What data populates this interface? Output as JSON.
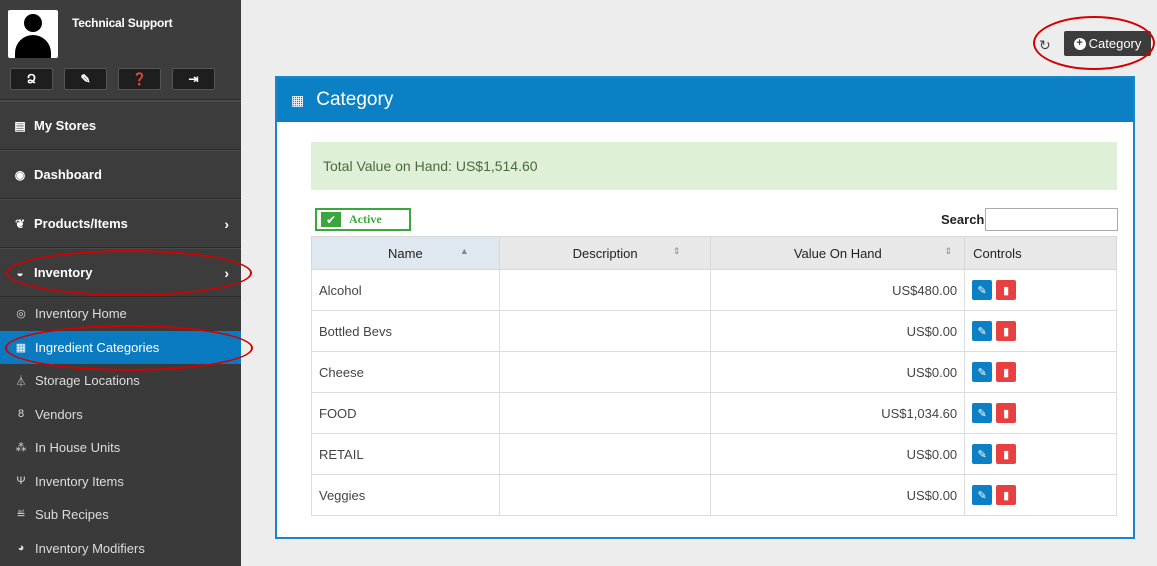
{
  "user": {
    "name": "Technical Support"
  },
  "profile_icons": [
    {
      "icon": "user-icon",
      "glyph": "Ձ"
    },
    {
      "icon": "brush-icon",
      "glyph": "✎"
    },
    {
      "icon": "help-icon",
      "glyph": "❓"
    },
    {
      "icon": "logout-icon",
      "glyph": "⇥"
    }
  ],
  "nav": {
    "my_stores": "My Stores",
    "dashboard": "Dashboard",
    "products": "Products/Items",
    "inventory": "Inventory"
  },
  "sub_nav": [
    {
      "name": "sub-item-inventory-home",
      "icon": "compass-icon",
      "glyph": "◎",
      "label": "Inventory Home",
      "active": false
    },
    {
      "name": "sub-item-ingredient-categories",
      "icon": "grid-icon",
      "glyph": "▦",
      "label": "Ingredient Categories",
      "active": true
    },
    {
      "name": "sub-item-storage-locations",
      "icon": "flask-icon",
      "glyph": "⏃",
      "label": "Storage Locations",
      "active": false
    },
    {
      "name": "sub-item-vendors",
      "icon": "vendor-icon",
      "glyph": "8",
      "label": "Vendors",
      "active": false
    },
    {
      "name": "sub-item-in-house-units",
      "icon": "cubes-icon",
      "glyph": "⁂",
      "label": "In House Units",
      "active": false
    },
    {
      "name": "sub-item-inventory-items",
      "icon": "utensils-icon",
      "glyph": "Ψ",
      "label": "Inventory Items",
      "active": false
    },
    {
      "name": "sub-item-sub-recipes",
      "icon": "recipe-icon",
      "glyph": "≝",
      "label": "Sub Recipes",
      "active": false
    },
    {
      "name": "sub-item-inventory-modifiers",
      "icon": "pie-icon",
      "glyph": "◕",
      "label": "Inventory Modifiers",
      "active": false
    }
  ],
  "toolbar": {
    "add_category_label": "Category"
  },
  "panel": {
    "title": "Category"
  },
  "summary": {
    "total_value": "Total Value on Hand: US$1,514.60"
  },
  "filter": {
    "active_label": "Active"
  },
  "search": {
    "label": "Search",
    "value": ""
  },
  "table": {
    "headers": {
      "name": "Name",
      "description": "Description",
      "value": "Value On Hand",
      "controls": "Controls"
    },
    "rows": [
      {
        "name": "Alcohol",
        "description": "",
        "value": "US$480.00"
      },
      {
        "name": "Bottled Bevs",
        "description": "",
        "value": "US$0.00"
      },
      {
        "name": "Cheese",
        "description": "",
        "value": "US$0.00"
      },
      {
        "name": "FOOD",
        "description": "",
        "value": "US$1,034.60"
      },
      {
        "name": "RETAIL",
        "description": "",
        "value": "US$0.00"
      },
      {
        "name": "Veggies",
        "description": "",
        "value": "US$0.00"
      }
    ]
  },
  "colors": {
    "accent": "#0b80c4",
    "sidebar": "#3b3b3b",
    "success": "#3ba63b",
    "danger": "#e84040",
    "annotation": "#d40000"
  }
}
